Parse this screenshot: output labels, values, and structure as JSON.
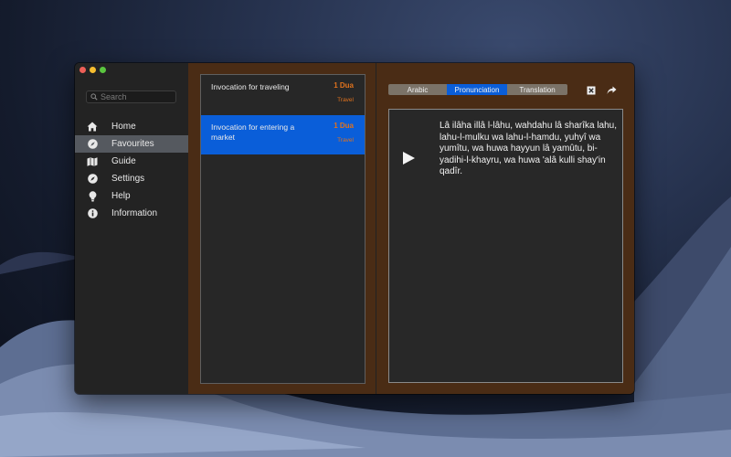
{
  "sidebar": {
    "search_placeholder": "Search",
    "items": [
      {
        "label": "Home",
        "icon": "house-icon"
      },
      {
        "label": "Favourites",
        "icon": "compass-icon",
        "selected": true
      },
      {
        "label": "Guide",
        "icon": "map-icon"
      },
      {
        "label": "Settings",
        "icon": "compass-icon"
      },
      {
        "label": "Help",
        "icon": "lightbulb-icon"
      },
      {
        "label": "Information",
        "icon": "info-icon"
      }
    ]
  },
  "list": {
    "items": [
      {
        "title": "Invocation for traveling",
        "count": "1 Dua",
        "category": "Travel"
      },
      {
        "title": "Invocation for entering a market",
        "count": "1 Dua",
        "category": "Travel",
        "selected": true
      }
    ]
  },
  "detail": {
    "tabs": [
      {
        "label": "Arabic"
      },
      {
        "label": "Pronunciation",
        "selected": true
      },
      {
        "label": "Translation"
      }
    ],
    "text": "Lâ ilâha illâ l-lâhu, wahdahu lâ sharîka lahu, lahu-l-mulku wa lahu-l-hamdu, yuhyî wa yumîtu, wa huwa hayyun lâ yamûtu, bi-yadihi-l-khayru, wa huwa 'alâ kulli shay'in qadîr."
  },
  "colors": {
    "accent": "#0a5ed9",
    "window_frame": "#4a2c15",
    "count_text": "#e0721d"
  }
}
